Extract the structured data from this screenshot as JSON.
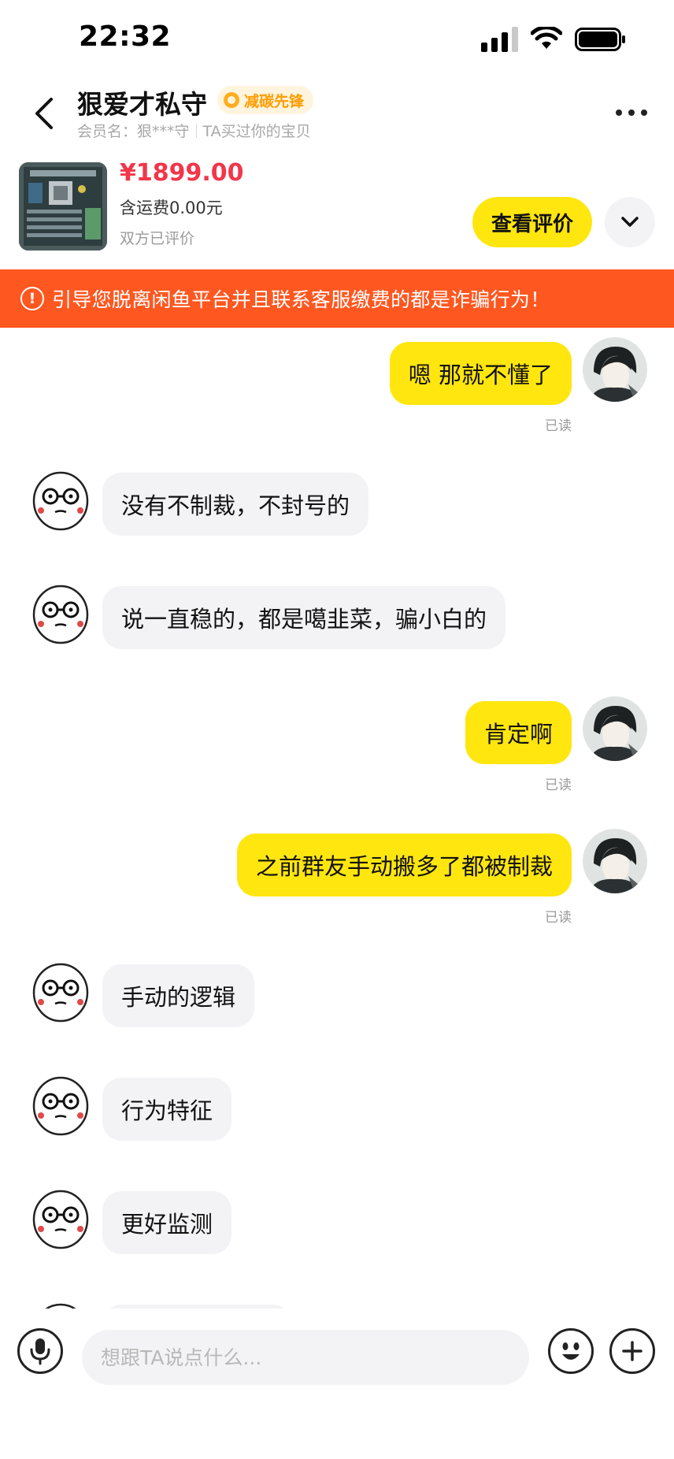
{
  "status_bar": {
    "time": "22:32"
  },
  "header": {
    "title": "狠爱才私守",
    "badge": "减碳先锋",
    "member_name": "会员名：狠***守",
    "relation": "TA买过你的宝贝"
  },
  "product": {
    "price": "¥1899.00",
    "shipping": "含运费0.00元",
    "status": "双方已评价",
    "review_button": "查看评价"
  },
  "warning": {
    "text": "引导您脱离闲鱼平台并且联系客服缴费的都是诈骗行为！"
  },
  "messages": [
    {
      "side": "out",
      "text": "嗯 那就不懂了",
      "read": "已读"
    },
    {
      "side": "in",
      "text": "没有不制裁，不封号的"
    },
    {
      "side": "in",
      "text": "说一直稳的，都是噶韭菜，骗小白的"
    },
    {
      "side": "out",
      "text": "肯定啊",
      "read": "已读"
    },
    {
      "side": "out",
      "text": "之前群友手动搬多了都被制裁",
      "read": "已读"
    },
    {
      "side": "in",
      "text": "手动的逻辑"
    },
    {
      "side": "in",
      "text": "行为特征"
    },
    {
      "side": "in",
      "text": "更好监测"
    }
  ],
  "input": {
    "placeholder": "想跟TA说点什么..."
  },
  "colors": {
    "accent_yellow": "#ffe60f",
    "warning": "#ff5720",
    "price": "#f2364a",
    "bubble_gray": "#f3f3f5"
  }
}
